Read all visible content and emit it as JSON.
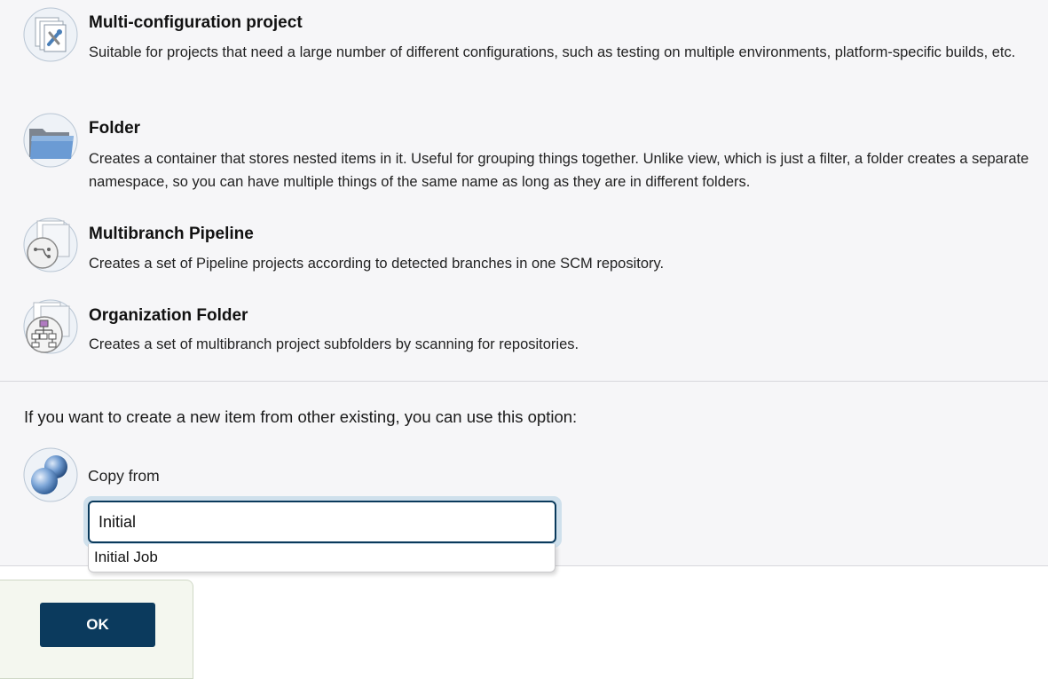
{
  "items": [
    {
      "title": "Multi-configuration project",
      "description": "Suitable for projects that need a large number of different configurations, such as testing on multiple environments, platform-specific builds, etc.",
      "icon": "multi-configuration-icon"
    },
    {
      "title": "Folder",
      "description": "Creates a container that stores nested items in it. Useful for grouping things together. Unlike view, which is just a filter, a folder creates a separate namespace, so you can have multiple things of the same name as long as they are in different folders.",
      "icon": "folder-icon"
    },
    {
      "title": "Multibranch Pipeline",
      "description": "Creates a set of Pipeline projects according to detected branches in one SCM repository.",
      "icon": "multibranch-pipeline-icon"
    },
    {
      "title": "Organization Folder",
      "description": "Creates a set of multibranch project subfolders by scanning for repositories.",
      "icon": "organization-folder-icon"
    }
  ],
  "copy": {
    "intro": "If you want to create a new item from other existing, you can use this option:",
    "label": "Copy from",
    "input_value": "Initial",
    "suggestions": [
      "Initial Job"
    ],
    "icon": "copy-spheres-icon"
  },
  "footer": {
    "ok_label": "OK"
  },
  "colors": {
    "panel_bg": "#f6f6f8",
    "primary": "#0b3a5d",
    "footer_bg": "#f4f7ef"
  }
}
